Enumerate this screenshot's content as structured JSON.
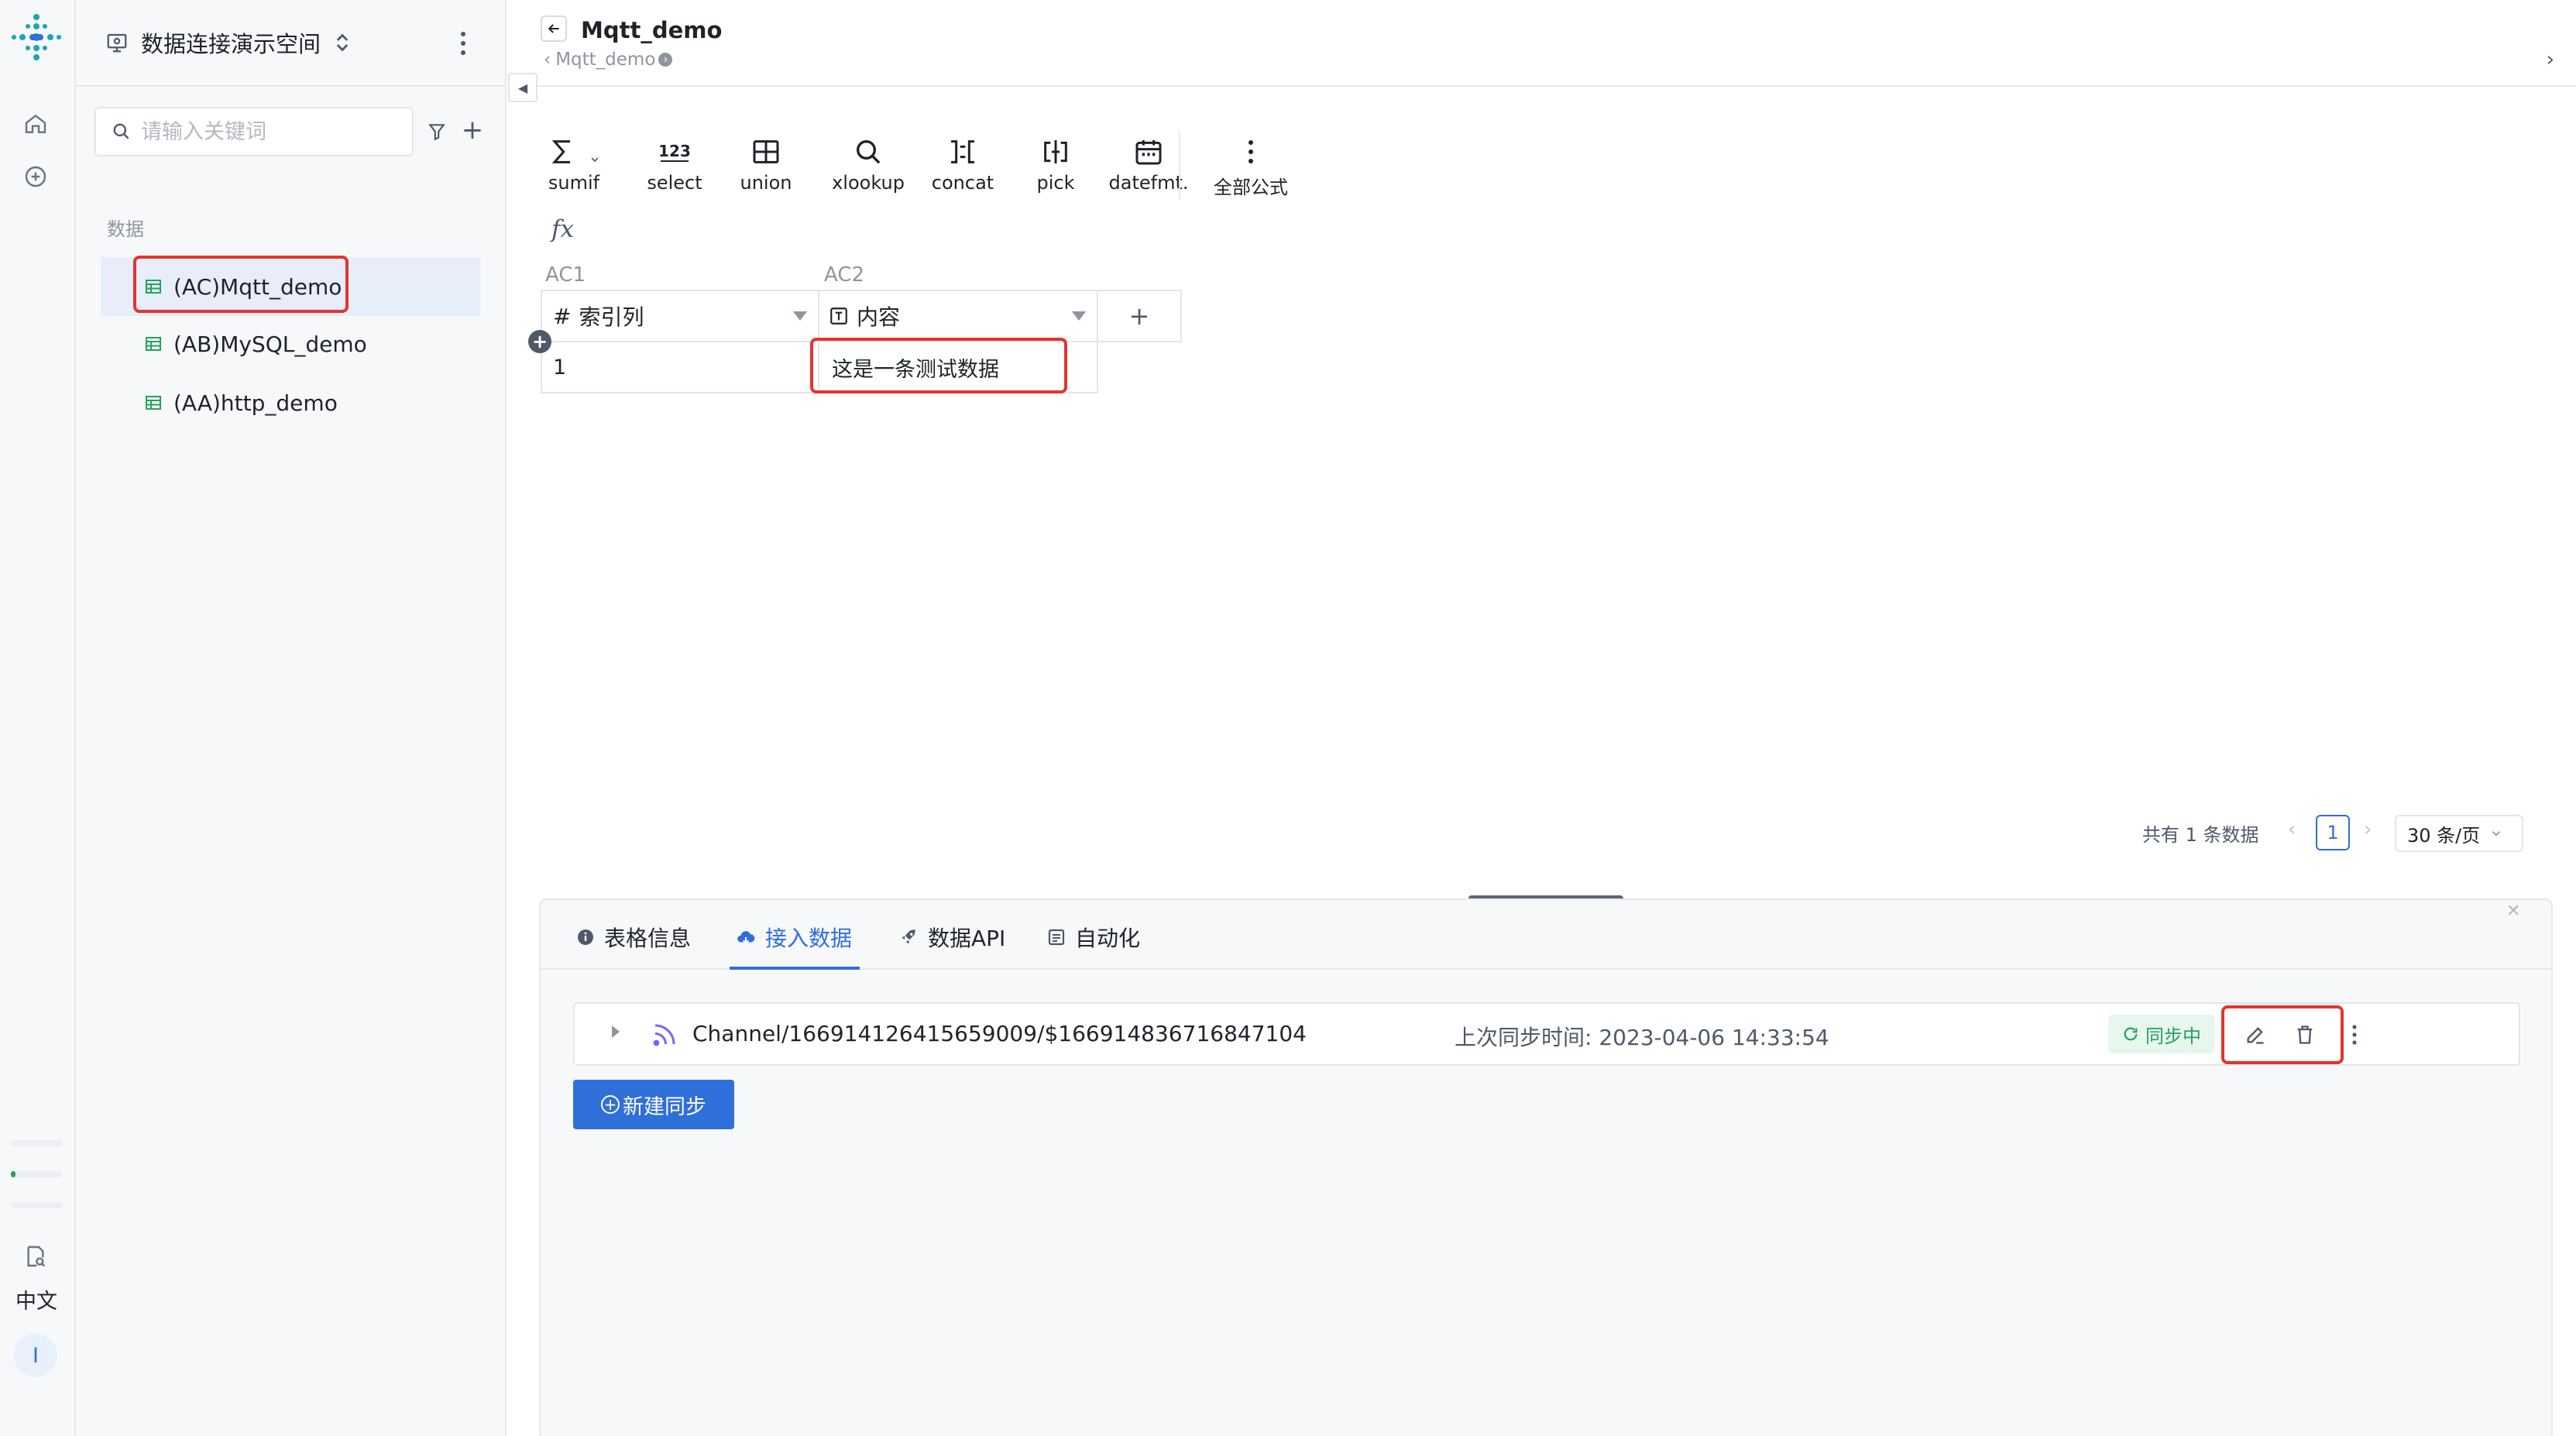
{
  "workspace": {
    "name": "数据连接演示空间"
  },
  "search": {
    "placeholder": "请输入关键词"
  },
  "sidebar": {
    "section_label": "数据",
    "items": [
      {
        "label": "(AC)Mqtt_demo",
        "active": true
      },
      {
        "label": "(AB)MySQL_demo",
        "active": false
      },
      {
        "label": "(AA)http_demo",
        "active": false
      }
    ]
  },
  "rail": {
    "language": "中文",
    "avatar_letter": "I"
  },
  "header": {
    "title": "Mqtt_demo",
    "breadcrumb": "Mqtt_demo"
  },
  "toolbar": {
    "tools": [
      {
        "icon": "sigma-icon",
        "label": "sumif"
      },
      {
        "icon": "number-icon",
        "label": "select"
      },
      {
        "icon": "union-icon",
        "label": "union"
      },
      {
        "icon": "search-icon",
        "label": "xlookup"
      },
      {
        "icon": "concat-icon",
        "label": "concat"
      },
      {
        "icon": "pick-icon",
        "label": "pick"
      },
      {
        "icon": "calendar-icon",
        "label": "datefmt."
      },
      {
        "icon": "more-vertical-icon",
        "label": "全部公式"
      }
    ],
    "fx": "fx"
  },
  "grid": {
    "columns": [
      {
        "code": "AC1",
        "name": "索引列",
        "type_icon": "hash-icon"
      },
      {
        "code": "AC2",
        "name": "内容",
        "type_icon": "text-type-icon"
      }
    ],
    "rows": [
      [
        "1",
        "这是一条测试数据"
      ]
    ],
    "add_column": "+"
  },
  "pager": {
    "total": "共有 1 条数据",
    "current": "1",
    "page_size": "30 条/页"
  },
  "panel": {
    "tabs": [
      {
        "label": "表格信息",
        "icon": "info-icon",
        "active": false
      },
      {
        "label": "接入数据",
        "icon": "cloud-icon",
        "active": true
      },
      {
        "label": "数据API",
        "icon": "rocket-icon",
        "active": false
      },
      {
        "label": "自动化",
        "icon": "automation-icon",
        "active": false
      }
    ],
    "sync": {
      "channel": "Channel/166914126415659009/$166914836716847104",
      "last_sync": "上次同步时间: 2023-04-06 14:33:54",
      "status": "同步中"
    },
    "new_sync_label": "新建同步"
  },
  "colors": {
    "accent": "#2f6fd9",
    "highlight": "#e5332f",
    "success": "#23a35a"
  }
}
